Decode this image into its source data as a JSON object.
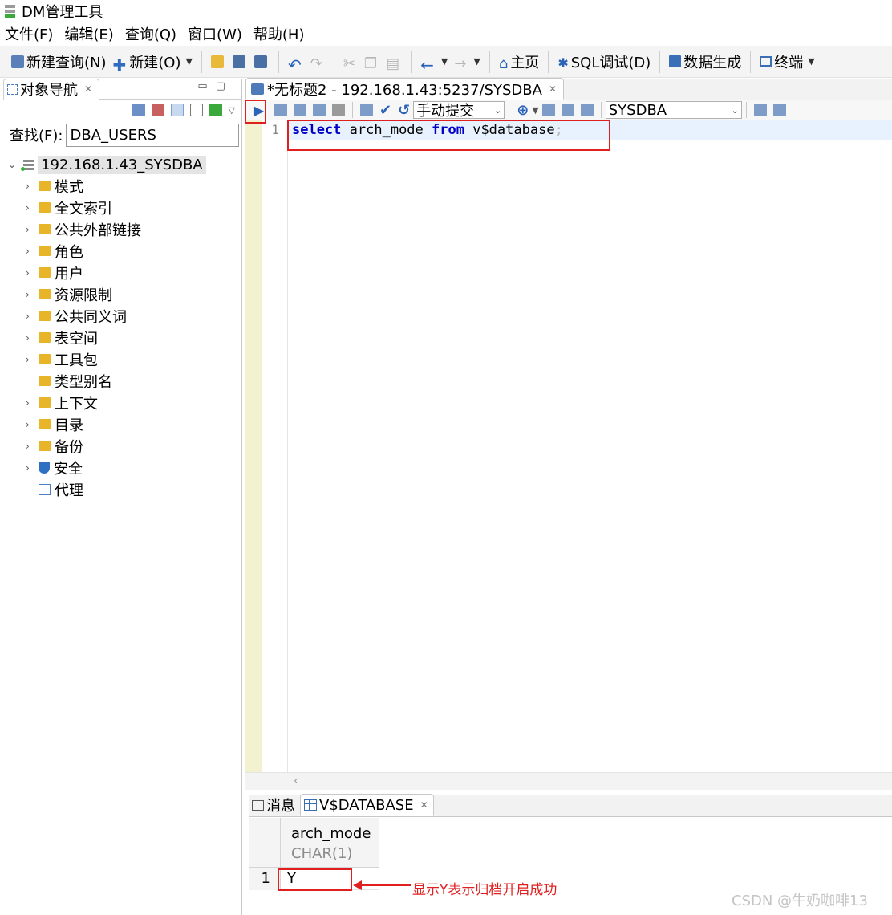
{
  "window": {
    "title": "DM管理工具"
  },
  "menu": [
    "文件(F)",
    "编辑(E)",
    "查询(Q)",
    "窗口(W)",
    "帮助(H)"
  ],
  "toolbar": {
    "new_query": "新建查询(N)",
    "new": "新建(O)",
    "home": "主页",
    "sql_debug": "SQL调试(D)",
    "data_gen": "数据生成",
    "terminal": "终端"
  },
  "navigator": {
    "tab_title": "对象导航",
    "search_label": "查找(F):",
    "search_value": "DBA_USERS",
    "root": "192.168.1.43_SYSDBA",
    "items": [
      "模式",
      "全文索引",
      "公共外部链接",
      "角色",
      "用户",
      "资源限制",
      "公共同义词",
      "表空间",
      "工具包",
      "类型别名",
      "上下文",
      "目录",
      "备份",
      "安全",
      "代理"
    ]
  },
  "editor": {
    "tab_title": "*无标题2 - 192.168.1.43:5237/SYSDBA",
    "commit_mode": "手动提交",
    "schema": "SYSDBA",
    "line_number": "1",
    "sql": {
      "kw1": "select",
      "part1": " arch_mode ",
      "kw2": "from",
      "part2": " v$database",
      "semicolon": ";"
    }
  },
  "results": {
    "tab_messages": "消息",
    "tab_result": "V$DATABASE",
    "column_name": "arch_mode",
    "column_type": "CHAR(1)",
    "row_number": "1",
    "value": "Y"
  },
  "annotation": "显示Y表示归档开启成功",
  "watermark": "CSDN @牛奶咖啡13",
  "colors": {
    "accent": "#2a62b8",
    "annotation_red": "#e02020",
    "keyword": "#0000c8"
  }
}
